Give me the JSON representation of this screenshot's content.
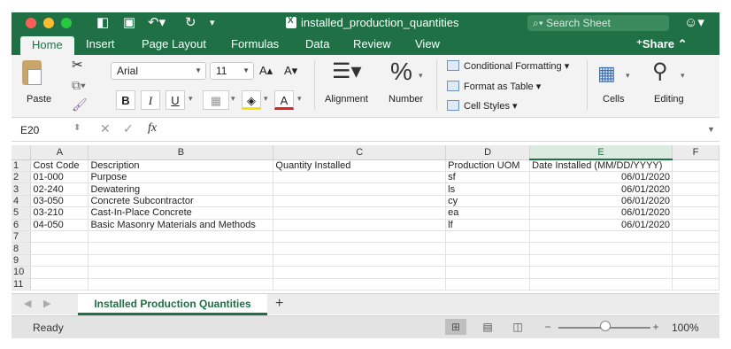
{
  "window": {
    "title": "installed_production_quantities",
    "search_placeholder": "Search Sheet"
  },
  "tabs": [
    "Home",
    "Insert",
    "Page Layout",
    "Formulas",
    "Data",
    "Review",
    "View"
  ],
  "share_label": "Share",
  "ribbon": {
    "paste_label": "Paste",
    "font_name": "Arial",
    "font_size": "11",
    "bold": "B",
    "italic": "I",
    "underline": "U",
    "alignment_label": "Alignment",
    "number_label": "Number",
    "conditional_formatting": "Conditional Formatting",
    "format_as_table": "Format as Table",
    "cell_styles": "Cell Styles",
    "cells_label": "Cells",
    "editing_label": "Editing"
  },
  "formula_bar": {
    "name_box": "E20",
    "formula": ""
  },
  "columns": [
    "A",
    "B",
    "C",
    "D",
    "E",
    "F"
  ],
  "selected_column": "E",
  "rows": [
    [
      "Cost Code",
      "Description",
      "Quantity Installed",
      "Production UOM",
      "Date Installed (MM/DD/YYYY)",
      ""
    ],
    [
      "01-000",
      "Purpose",
      "",
      "sf",
      "06/01/2020",
      ""
    ],
    [
      "02-240",
      "Dewatering",
      "",
      "ls",
      "06/01/2020",
      ""
    ],
    [
      "03-050",
      "Concrete Subcontractor",
      "",
      "cy",
      "06/01/2020",
      ""
    ],
    [
      "03-210",
      "Cast-In-Place Concrete",
      "",
      "ea",
      "06/01/2020",
      ""
    ],
    [
      "04-050",
      "Basic Masonry Materials and Methods",
      "",
      "lf",
      "06/01/2020",
      ""
    ],
    [
      "",
      "",
      "",
      "",
      "",
      ""
    ],
    [
      "",
      "",
      "",
      "",
      "",
      ""
    ],
    [
      "",
      "",
      "",
      "",
      "",
      ""
    ],
    [
      "",
      "",
      "",
      "",
      "",
      ""
    ],
    [
      "",
      "",
      "",
      "",
      "",
      ""
    ]
  ],
  "sheet_tabs": {
    "active": "Installed Production Quantities",
    "add": "+"
  },
  "status": {
    "ready": "Ready",
    "zoom": "100%",
    "zoom_level": 1.0
  },
  "colors": {
    "accent": "#1f7145",
    "ribbon_bg": "#f3f3f3"
  }
}
